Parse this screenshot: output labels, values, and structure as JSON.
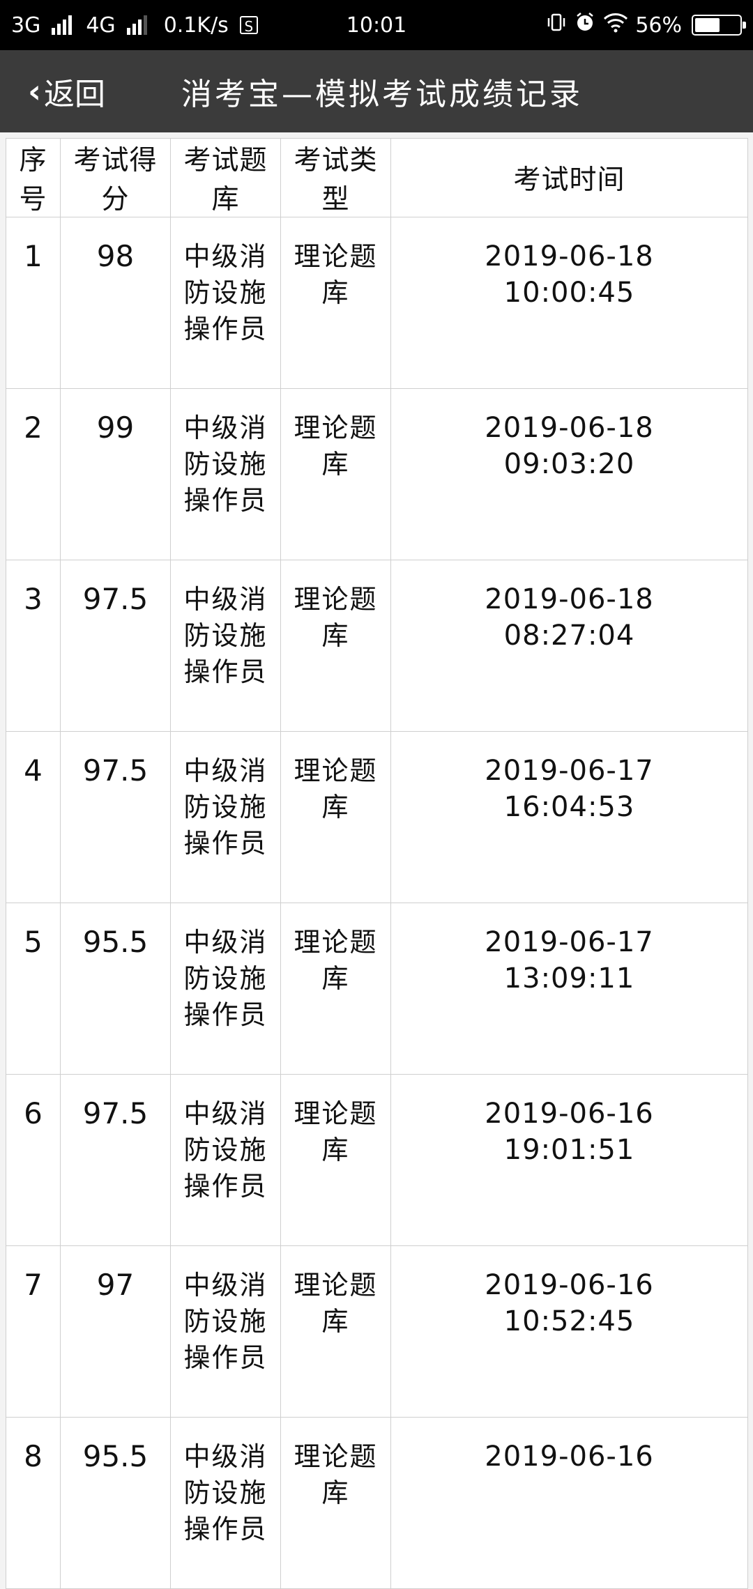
{
  "statusbar": {
    "network1": "3G",
    "network2": "4G",
    "speed": "0.1K/s",
    "s_badge": "S",
    "time": "10:01",
    "battery": "56%",
    "battery_level": 0.56
  },
  "navbar": {
    "back_label": "返回",
    "title": "消考宝—模拟考试成绩记录"
  },
  "table": {
    "headers": [
      "序号",
      "考试得分",
      "考试题库",
      "考试类型",
      "考试时间"
    ],
    "rows": [
      {
        "no": "1",
        "score": "98",
        "bank": "中级消防设施操作员",
        "type": "理论题库",
        "date": "2019-06-18",
        "time": "10:00:45"
      },
      {
        "no": "2",
        "score": "99",
        "bank": "中级消防设施操作员",
        "type": "理论题库",
        "date": "2019-06-18",
        "time": "09:03:20"
      },
      {
        "no": "3",
        "score": "97.5",
        "bank": "中级消防设施操作员",
        "type": "理论题库",
        "date": "2019-06-18",
        "time": "08:27:04"
      },
      {
        "no": "4",
        "score": "97.5",
        "bank": "中级消防设施操作员",
        "type": "理论题库",
        "date": "2019-06-17",
        "time": "16:04:53"
      },
      {
        "no": "5",
        "score": "95.5",
        "bank": "中级消防设施操作员",
        "type": "理论题库",
        "date": "2019-06-17",
        "time": "13:09:11"
      },
      {
        "no": "6",
        "score": "97.5",
        "bank": "中级消防设施操作员",
        "type": "理论题库",
        "date": "2019-06-16",
        "time": "19:01:51"
      },
      {
        "no": "7",
        "score": "97",
        "bank": "中级消防设施操作员",
        "type": "理论题库",
        "date": "2019-06-16",
        "time": "10:52:45"
      },
      {
        "no": "8",
        "score": "95.5",
        "bank": "中级消防设施操作员",
        "type": "理论题库",
        "date": "2019-06-16",
        "time": ""
      }
    ]
  }
}
